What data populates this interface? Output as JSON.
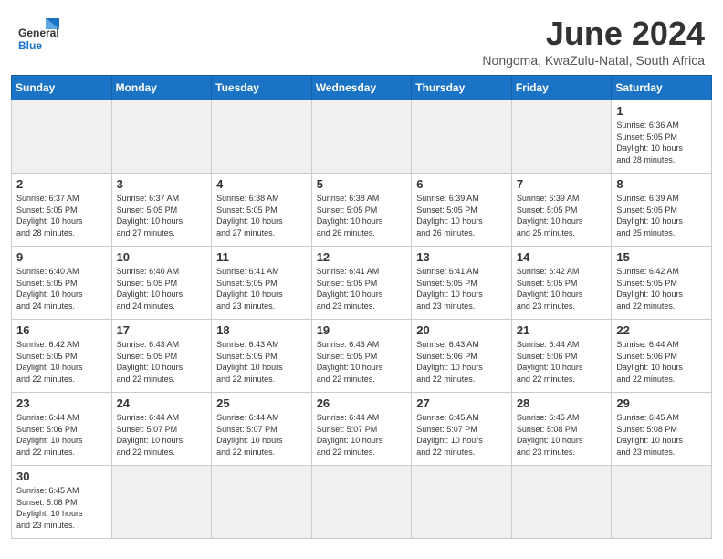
{
  "header": {
    "logo_general": "General",
    "logo_blue": "Blue",
    "month_year": "June 2024",
    "location": "Nongoma, KwaZulu-Natal, South Africa"
  },
  "weekdays": [
    "Sunday",
    "Monday",
    "Tuesday",
    "Wednesday",
    "Thursday",
    "Friday",
    "Saturday"
  ],
  "weeks": [
    [
      {
        "day": "",
        "info": ""
      },
      {
        "day": "",
        "info": ""
      },
      {
        "day": "",
        "info": ""
      },
      {
        "day": "",
        "info": ""
      },
      {
        "day": "",
        "info": ""
      },
      {
        "day": "",
        "info": ""
      },
      {
        "day": "1",
        "info": "Sunrise: 6:36 AM\nSunset: 5:05 PM\nDaylight: 10 hours\nand 28 minutes."
      }
    ],
    [
      {
        "day": "2",
        "info": "Sunrise: 6:37 AM\nSunset: 5:05 PM\nDaylight: 10 hours\nand 28 minutes."
      },
      {
        "day": "3",
        "info": "Sunrise: 6:37 AM\nSunset: 5:05 PM\nDaylight: 10 hours\nand 27 minutes."
      },
      {
        "day": "4",
        "info": "Sunrise: 6:38 AM\nSunset: 5:05 PM\nDaylight: 10 hours\nand 27 minutes."
      },
      {
        "day": "5",
        "info": "Sunrise: 6:38 AM\nSunset: 5:05 PM\nDaylight: 10 hours\nand 26 minutes."
      },
      {
        "day": "6",
        "info": "Sunrise: 6:39 AM\nSunset: 5:05 PM\nDaylight: 10 hours\nand 26 minutes."
      },
      {
        "day": "7",
        "info": "Sunrise: 6:39 AM\nSunset: 5:05 PM\nDaylight: 10 hours\nand 25 minutes."
      },
      {
        "day": "8",
        "info": "Sunrise: 6:39 AM\nSunset: 5:05 PM\nDaylight: 10 hours\nand 25 minutes."
      }
    ],
    [
      {
        "day": "9",
        "info": "Sunrise: 6:40 AM\nSunset: 5:05 PM\nDaylight: 10 hours\nand 24 minutes."
      },
      {
        "day": "10",
        "info": "Sunrise: 6:40 AM\nSunset: 5:05 PM\nDaylight: 10 hours\nand 24 minutes."
      },
      {
        "day": "11",
        "info": "Sunrise: 6:41 AM\nSunset: 5:05 PM\nDaylight: 10 hours\nand 23 minutes."
      },
      {
        "day": "12",
        "info": "Sunrise: 6:41 AM\nSunset: 5:05 PM\nDaylight: 10 hours\nand 23 minutes."
      },
      {
        "day": "13",
        "info": "Sunrise: 6:41 AM\nSunset: 5:05 PM\nDaylight: 10 hours\nand 23 minutes."
      },
      {
        "day": "14",
        "info": "Sunrise: 6:42 AM\nSunset: 5:05 PM\nDaylight: 10 hours\nand 23 minutes."
      },
      {
        "day": "15",
        "info": "Sunrise: 6:42 AM\nSunset: 5:05 PM\nDaylight: 10 hours\nand 22 minutes."
      }
    ],
    [
      {
        "day": "16",
        "info": "Sunrise: 6:42 AM\nSunset: 5:05 PM\nDaylight: 10 hours\nand 22 minutes."
      },
      {
        "day": "17",
        "info": "Sunrise: 6:43 AM\nSunset: 5:05 PM\nDaylight: 10 hours\nand 22 minutes."
      },
      {
        "day": "18",
        "info": "Sunrise: 6:43 AM\nSunset: 5:05 PM\nDaylight: 10 hours\nand 22 minutes."
      },
      {
        "day": "19",
        "info": "Sunrise: 6:43 AM\nSunset: 5:05 PM\nDaylight: 10 hours\nand 22 minutes."
      },
      {
        "day": "20",
        "info": "Sunrise: 6:43 AM\nSunset: 5:06 PM\nDaylight: 10 hours\nand 22 minutes."
      },
      {
        "day": "21",
        "info": "Sunrise: 6:44 AM\nSunset: 5:06 PM\nDaylight: 10 hours\nand 22 minutes."
      },
      {
        "day": "22",
        "info": "Sunrise: 6:44 AM\nSunset: 5:06 PM\nDaylight: 10 hours\nand 22 minutes."
      }
    ],
    [
      {
        "day": "23",
        "info": "Sunrise: 6:44 AM\nSunset: 5:06 PM\nDaylight: 10 hours\nand 22 minutes."
      },
      {
        "day": "24",
        "info": "Sunrise: 6:44 AM\nSunset: 5:07 PM\nDaylight: 10 hours\nand 22 minutes."
      },
      {
        "day": "25",
        "info": "Sunrise: 6:44 AM\nSunset: 5:07 PM\nDaylight: 10 hours\nand 22 minutes."
      },
      {
        "day": "26",
        "info": "Sunrise: 6:44 AM\nSunset: 5:07 PM\nDaylight: 10 hours\nand 22 minutes."
      },
      {
        "day": "27",
        "info": "Sunrise: 6:45 AM\nSunset: 5:07 PM\nDaylight: 10 hours\nand 22 minutes."
      },
      {
        "day": "28",
        "info": "Sunrise: 6:45 AM\nSunset: 5:08 PM\nDaylight: 10 hours\nand 23 minutes."
      },
      {
        "day": "29",
        "info": "Sunrise: 6:45 AM\nSunset: 5:08 PM\nDaylight: 10 hours\nand 23 minutes."
      }
    ],
    [
      {
        "day": "30",
        "info": "Sunrise: 6:45 AM\nSunset: 5:08 PM\nDaylight: 10 hours\nand 23 minutes."
      },
      {
        "day": "",
        "info": ""
      },
      {
        "day": "",
        "info": ""
      },
      {
        "day": "",
        "info": ""
      },
      {
        "day": "",
        "info": ""
      },
      {
        "day": "",
        "info": ""
      },
      {
        "day": "",
        "info": ""
      }
    ]
  ]
}
